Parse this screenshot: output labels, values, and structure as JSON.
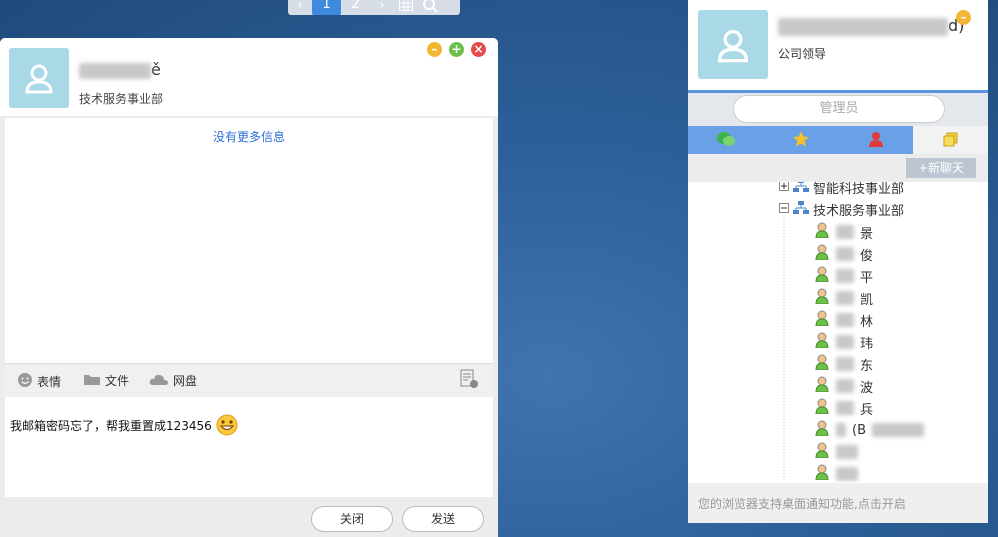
{
  "pager": {
    "prev": "‹",
    "pages": [
      "1",
      "2"
    ],
    "next": "›"
  },
  "chat": {
    "name_suffix": "ě",
    "dept": "技术服务事业部",
    "history_hint": "没有更多信息",
    "toolbar": {
      "emoji": "表情",
      "file": "文件",
      "netdisk": "网盘"
    },
    "input_text": "我邮箱密码忘了，帮我重置成123456",
    "close": "关闭",
    "send": "发送"
  },
  "panel": {
    "name_tail": "d)",
    "role": "公司领导",
    "search_placeholder": "管理员",
    "new_chat": "+新聊天",
    "tree": {
      "group_collapsed": "智能科技事业部",
      "group_expanded": "技术服务事业部",
      "members": [
        "景",
        "俊",
        "平",
        "凯",
        "林",
        "玮",
        "东",
        "波",
        "兵",
        "(B",
        "",
        ""
      ]
    },
    "footer": "您的浏览器支持桌面通知功能,点击开启"
  },
  "colors": {
    "accent": "#3d8adf",
    "avatar_bg": "#a9d8e6",
    "tab_bar": "#6aa1e6"
  }
}
